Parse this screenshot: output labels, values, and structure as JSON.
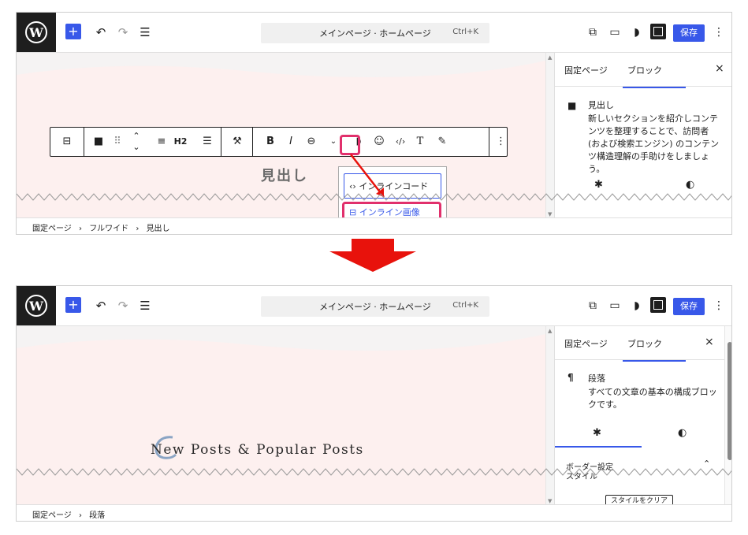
{
  "colors": {
    "accent": "#3858e9",
    "highlight": "#e1306c",
    "arrow": "#e8120c",
    "canvas_bg": "#fdf0ef"
  },
  "top": {
    "command_title": "メインページ · ホームページ",
    "command_shortcut": "Ctrl+K",
    "save_label": "保存",
    "add_label": "+"
  },
  "panel1": {
    "sidebar": {
      "tab_page": "固定ページ",
      "tab_block": "ブロック",
      "close": "×",
      "block_title": "見出し",
      "block_desc": "新しいセクションを紹介しコンテンツを整理することで、訪問者 (および検索エンジン) のコンテンツ構造理解の手助けをしましょう。"
    },
    "toolbar": {
      "h2": "H2",
      "bold": "B",
      "italic": "I"
    },
    "heading": "見出し",
    "dropdown": {
      "item1": "インラインコード",
      "item2": "インライン画像"
    },
    "breadcrumb": [
      "固定ページ",
      "フルワイド",
      "見出し"
    ]
  },
  "panel2": {
    "sidebar": {
      "tab_page": "固定ページ",
      "tab_block": "ブロック",
      "close": "×",
      "block_title": "段落",
      "block_desc": "すべての文章の基本の構成ブロックです。",
      "border_label": "ボーダー設定",
      "style_label": "スタイル",
      "clear_label": "スタイルをクリア"
    },
    "content_title": "New Posts & Popular Posts",
    "breadcrumb": [
      "固定ページ",
      "段落"
    ]
  },
  "breadcrumb_sep": "›"
}
